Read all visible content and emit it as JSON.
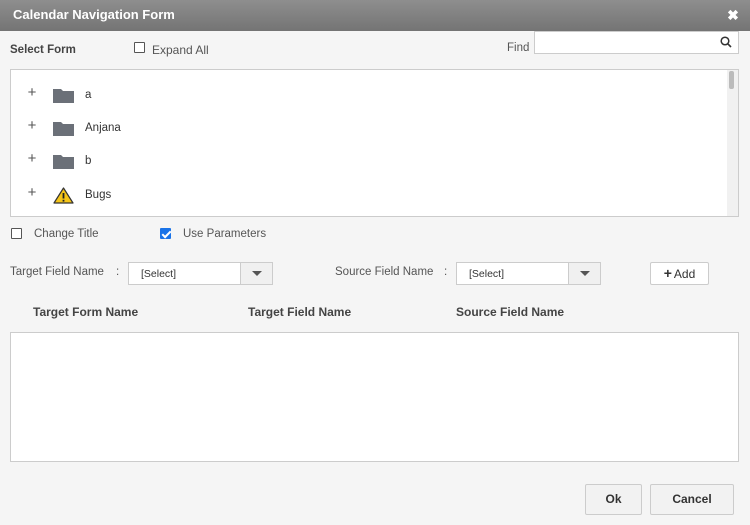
{
  "dialog": {
    "title": "Calendar Navigation Form",
    "close_icon": "close-icon"
  },
  "form_select": {
    "label": "Select Form",
    "expand_all_label": "Expand All",
    "expand_all_checked": false,
    "find_label": "Find",
    "find_value": "",
    "find_placeholder": ""
  },
  "tree": {
    "items": [
      {
        "label": "a",
        "icon": "folder-icon"
      },
      {
        "label": "Anjana",
        "icon": "folder-icon"
      },
      {
        "label": "b",
        "icon": "folder-icon"
      },
      {
        "label": "Bugs",
        "icon": "warning-icon"
      }
    ]
  },
  "options": {
    "change_title_label": "Change Title",
    "change_title_checked": false,
    "use_parameters_label": "Use Parameters",
    "use_parameters_checked": true
  },
  "mapping": {
    "target_field_label": "Target Field Name",
    "target_field_value": "[Select]",
    "source_field_label": "Source Field Name",
    "source_field_value": "[Select]",
    "add_label": "Add",
    "colon": ":"
  },
  "grid": {
    "headers": [
      "Target Form Name",
      "Target Field Name",
      "Source Field Name"
    ]
  },
  "footer": {
    "ok_label": "Ok",
    "cancel_label": "Cancel"
  },
  "colors": {
    "titlebar": "#808080",
    "checkbox_checked": "#1a73e8",
    "folder": "#6b7078",
    "warning": "#f5c518"
  }
}
